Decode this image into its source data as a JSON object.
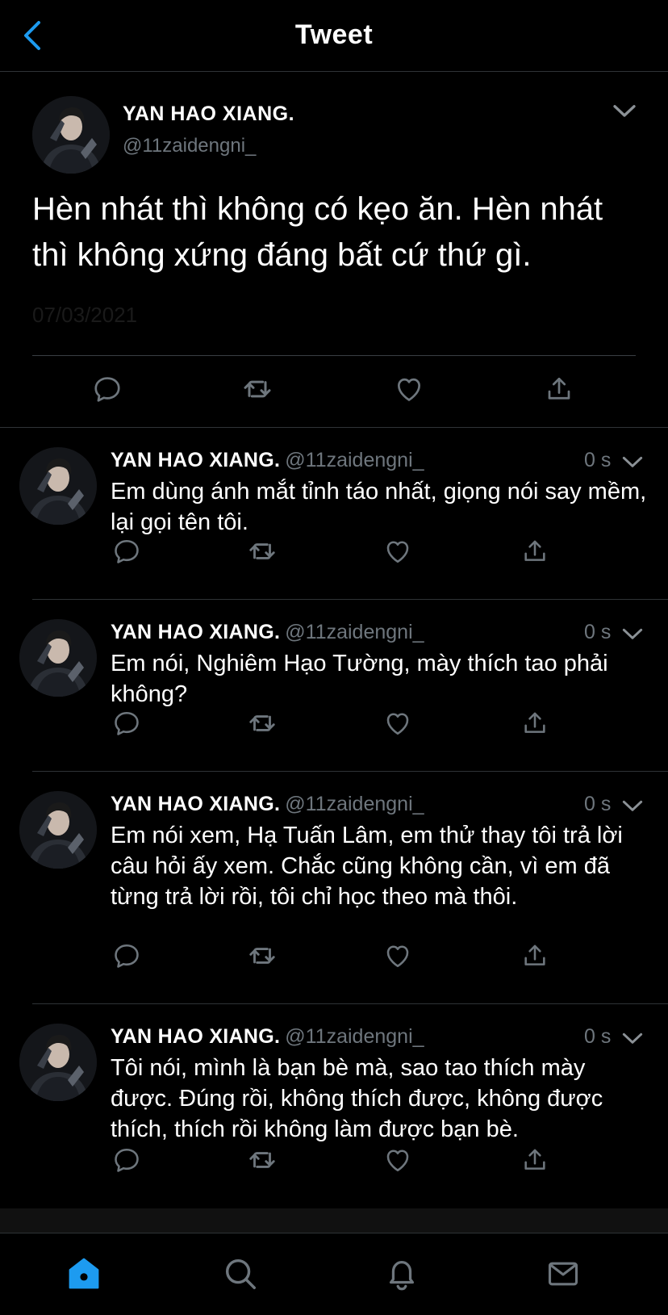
{
  "header": {
    "title": "Tweet",
    "back_icon": "chevron-left-icon",
    "accent": "#1d9bf0"
  },
  "main_tweet": {
    "name": "YAN HAO XIANG.",
    "handle": "@11zaidengni_",
    "text": "Hèn nhát thì không có kẹo ăn. Hèn nhát thì không xứng đáng bất cứ thứ gì.",
    "date": "07/03/2021"
  },
  "replies": [
    {
      "name": "YAN HAO XIANG.",
      "handle": "@11zaidengni_",
      "time": "0 s",
      "text": "Em dùng ánh mắt tỉnh táo nhất, giọng nói say mềm, lại gọi tên tôi."
    },
    {
      "name": "YAN HAO XIANG.",
      "handle": "@11zaidengni_",
      "time": "0 s",
      "text": "Em nói, Nghiêm Hạo Tường, mày thích tao phải không?"
    },
    {
      "name": "YAN HAO XIANG.",
      "handle": "@11zaidengni_",
      "time": "0 s",
      "text": "Em nói xem, Hạ Tuấn Lâm, em thử thay tôi trả lời câu hỏi ấy xem. Chắc cũng không cần, vì em đã từng trả lời rồi, tôi chỉ học theo mà thôi."
    },
    {
      "name": "YAN HAO XIANG.",
      "handle": "@11zaidengni_",
      "time": "0 s",
      "text": "Tôi nói, mình là bạn bè mà, sao tao thích mày được. Đúng rồi, không thích được, không được thích, thích rồi không làm được bạn bè."
    }
  ],
  "tabbar": {
    "items": [
      "home-icon",
      "search-icon",
      "notifications-icon",
      "messages-icon"
    ],
    "active_color": "#1d9bf0",
    "inactive_color": "#6e767d"
  }
}
